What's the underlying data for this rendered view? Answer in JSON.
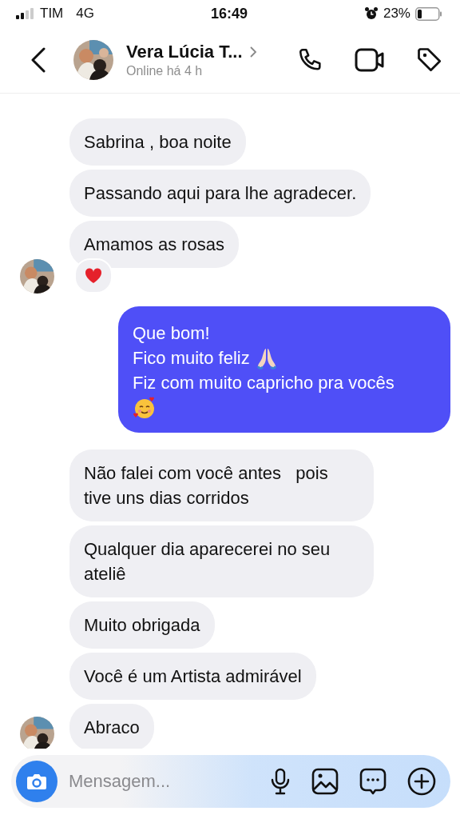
{
  "status_bar": {
    "carrier": "TIM",
    "network": "4G",
    "time": "16:49",
    "battery": "23%"
  },
  "header": {
    "name": "Vera Lúcia T...",
    "status": "Online há 4 h"
  },
  "messages": [
    {
      "kind": "incoming",
      "text": "Sabrina , boa noite",
      "avatar": false
    },
    {
      "kind": "incoming",
      "text": "Passando aqui para lhe agradecer.",
      "avatar": false
    },
    {
      "kind": "incoming",
      "text": "Amamos as rosas",
      "avatar": true,
      "reaction": {
        "kind": "heart"
      }
    },
    {
      "kind": "outgoing",
      "lines": [
        {
          "text": "Que bom!"
        },
        {
          "text": "Fico muito feliz",
          "emoji": {
            "kind": "pray"
          }
        },
        {
          "text": "Fiz com muito capricho pra vocês"
        },
        {
          "emoji": {
            "kind": "smiling-hearts"
          }
        }
      ]
    },
    {
      "kind": "incoming",
      "text": "Não falei com você antes   pois tive uns dias corridos",
      "avatar": false
    },
    {
      "kind": "incoming",
      "text": "Qualquer dia aparecerei no seu ateliê",
      "avatar": false
    },
    {
      "kind": "incoming",
      "text": "Muito obrigada",
      "avatar": false
    },
    {
      "kind": "incoming",
      "text": "Você é um Artista admirável",
      "avatar": false
    },
    {
      "kind": "incoming",
      "text": "Abraco",
      "avatar": true
    }
  ],
  "composer": {
    "placeholder": "Mensagem..."
  }
}
